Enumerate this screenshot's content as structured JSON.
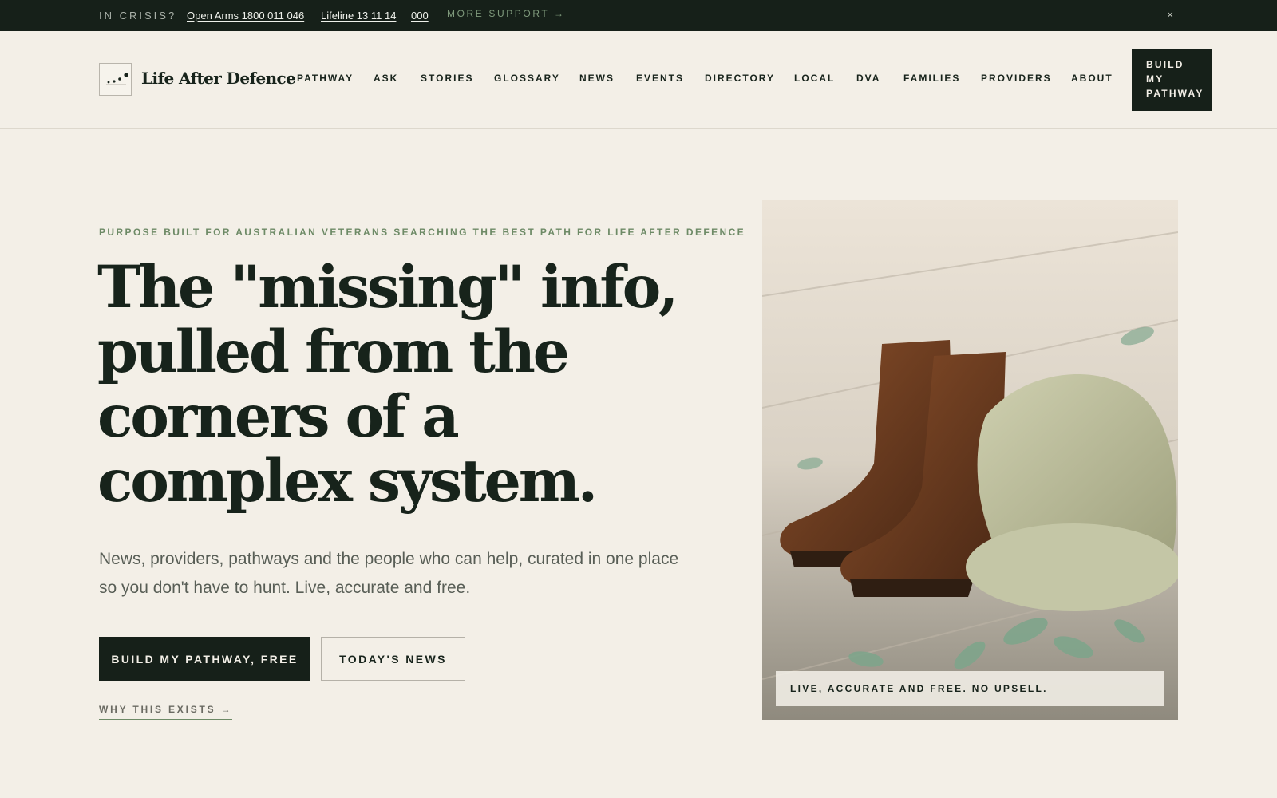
{
  "crisis_bar": {
    "label": "IN CRISIS?",
    "links": [
      "Open Arms 1800 011 046",
      "Lifeline 13 11 14",
      "000"
    ],
    "more_support": "MORE SUPPORT →",
    "close": "×"
  },
  "header": {
    "brand": "Life After Defence",
    "nav": [
      "PATHWAY",
      "ASK",
      "STORIES",
      "GLOSSARY",
      "NEWS",
      "EVENTS",
      "DIRECTORY",
      "LOCAL",
      "DVA",
      "FAMILIES",
      "PROVIDERS",
      "ABOUT"
    ],
    "cta_lines": [
      "BUILD",
      "MY",
      "PATHWAY"
    ]
  },
  "hero": {
    "eyebrow": "PURPOSE BUILT FOR AUSTRALIAN VETERANS SEARCHING THE BEST PATH FOR LIFE AFTER DEFENCE",
    "headline": "The \"missing\" info, pulled from the corners of a complex system.",
    "lede": "News, providers, pathways and the people who can help, curated in one place so you don't have to hunt. Live, accurate and free.",
    "primary_button": "BUILD MY PATHWAY, FREE",
    "secondary_button": "TODAY'S NEWS",
    "why_link": "WHY THIS EXISTS →",
    "image_caption": "LIVE, ACCURATE AND FREE. NO UPSELL."
  },
  "colors": {
    "background": "#f3efe7",
    "dark": "#162019",
    "accent_green": "#6d8a66"
  }
}
